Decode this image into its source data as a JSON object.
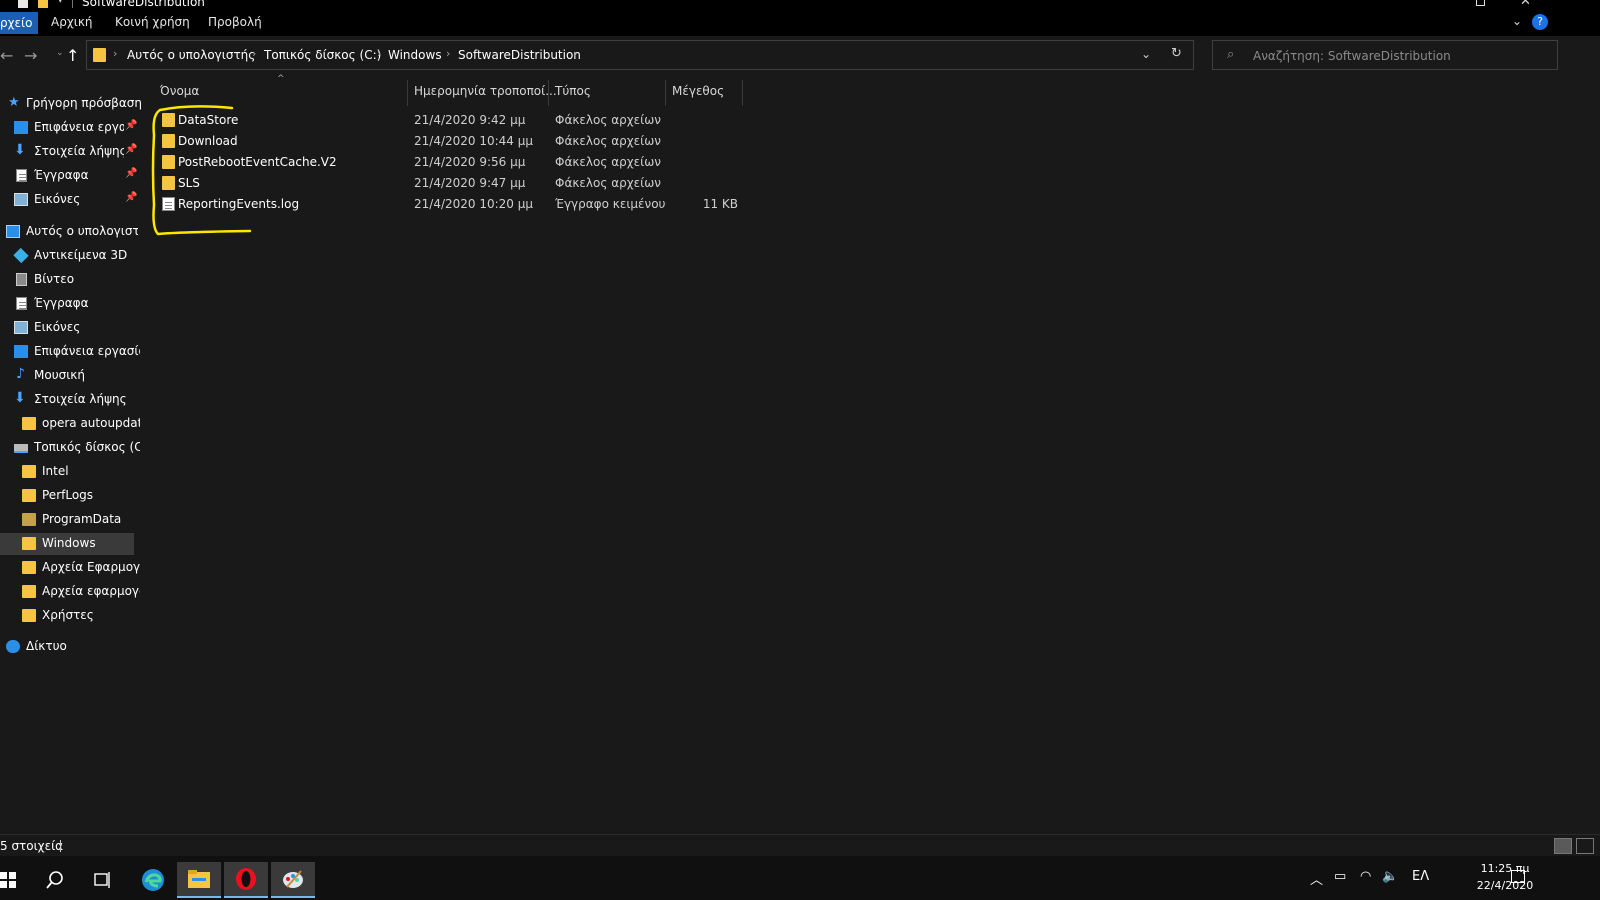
{
  "window": {
    "title": "SoftwareDistribution"
  },
  "ribbon": {
    "tabs": [
      "Αρχείο",
      "Αρχική",
      "Κοινή χρήση",
      "Προβολή"
    ],
    "file_tab_visible": "ρχείο"
  },
  "address": {
    "crumbs": [
      "Αυτός ο υπολογιστής",
      "Τοπικός δίσκος (C:)",
      "Windows",
      "SoftwareDistribution"
    ],
    "search_placeholder": "Αναζήτηση: SoftwareDistribution"
  },
  "nav": {
    "quick_access": "Γρήγορη πρόσβαση",
    "quick_items": [
      "Επιφάνεια εργασ",
      "Στοιχεία λήψης",
      "Έγγραφα",
      "Εικόνες"
    ],
    "this_pc": "Αυτός ο υπολογιστής",
    "pc_items": [
      "Αντικείμενα 3D",
      "Βίντεο",
      "Έγγραφα",
      "Εικόνες",
      "Επιφάνεια εργασίας",
      "Μουσική",
      "Στοιχεία λήψης",
      "opera autoupdate",
      "Τοπικός δίσκος (C:)",
      "Intel",
      "PerfLogs",
      "ProgramData",
      "Windows",
      "Αρχεία Εφαρμογών",
      "Αρχεία εφαρμογών",
      "Χρήστες"
    ],
    "network": "Δίκτυο"
  },
  "columns": {
    "name": "Όνομα",
    "date": "Ημερομηνία τροποποί...",
    "type": "Τύπος",
    "size": "Μέγεθος"
  },
  "files": [
    {
      "name": "DataStore",
      "date": "21/4/2020 9:42 μμ",
      "type": "Φάκελος αρχείων",
      "size": ""
    },
    {
      "name": "Download",
      "date": "21/4/2020 10:44 μμ",
      "type": "Φάκελος αρχείων",
      "size": ""
    },
    {
      "name": "PostRebootEventCache.V2",
      "date": "21/4/2020 9:56 μμ",
      "type": "Φάκελος αρχείων",
      "size": ""
    },
    {
      "name": "SLS",
      "date": "21/4/2020 9:47 μμ",
      "type": "Φάκελος αρχείων",
      "size": ""
    },
    {
      "name": "ReportingEvents.log",
      "date": "21/4/2020 10:20 μμ",
      "type": "Έγγραφο κειμένου",
      "size": "11 KB"
    }
  ],
  "status": {
    "items_text": "5 στοιχεία"
  },
  "taskbar": {
    "lang": "ΕΛ",
    "time": "11:25 πμ",
    "date": "22/4/2020"
  },
  "colors": {
    "accent": "#1a5fb4",
    "folder": "#f5c542",
    "highlight": "#ffe600",
    "opera": "#e8121f"
  }
}
